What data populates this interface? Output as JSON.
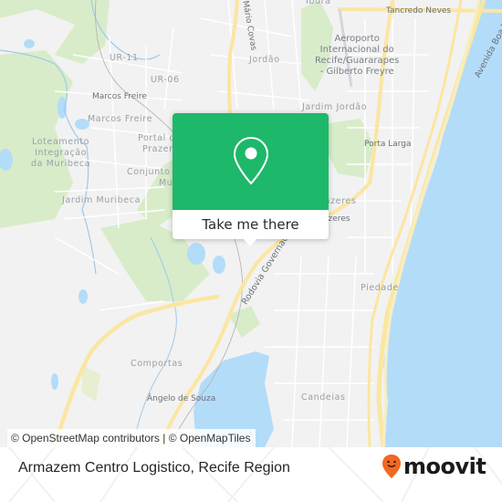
{
  "map": {
    "labels": {
      "ibura": "Ibura",
      "tancredo_neves": "Tancredo Neves",
      "mario_covas": "Mário Covas",
      "ur11": "UR-11",
      "ur06": "UR-06",
      "jordao": "Jordão",
      "airport": [
        "Aeroporto",
        "Internacional do",
        "Recife/Guararapes",
        "- Gilberto Freyre"
      ],
      "avenida_boa_viagem": "Avenida Boa Viagem",
      "marcos_freire_small": "Marcos Freire",
      "marcos_freire": "Marcos Freire",
      "jardim_jordao": "Jardim Jordão",
      "loteamento": [
        "Loteamento",
        "Integração",
        "da Muribeca"
      ],
      "portal_prazeres": [
        "Portal do",
        "Prazeres"
      ],
      "porta_larga": "Porta Larga",
      "conjunto_muribeca": [
        "Conjunto",
        "Muribeca"
      ],
      "jardim_muribeca": "Jardim Muribeca",
      "prazeres": "Prazeres",
      "prazeres_small": "Prazeres",
      "rodovia": "Rodovia Governador",
      "piedade": "Piedade",
      "comportas": "Comportas",
      "angelo_de_souza": "Ângelo de Souza",
      "candeias": "Candeias"
    },
    "attribution": "© OpenStreetMap contributors | © OpenMapTiles",
    "colors": {
      "land": "#f2f2f2",
      "park": "#d8ecc9",
      "water": "#b3dcf9",
      "highway": "#fbe6a2",
      "road": "#ffffff"
    }
  },
  "popup": {
    "icon": "location-pin-icon",
    "button_label": "Take me there",
    "color": "#1db86a"
  },
  "footer": {
    "title": "Armazem Centro Logistico, Recife Region",
    "brand": "moovit",
    "brand_color": "#f26722"
  }
}
